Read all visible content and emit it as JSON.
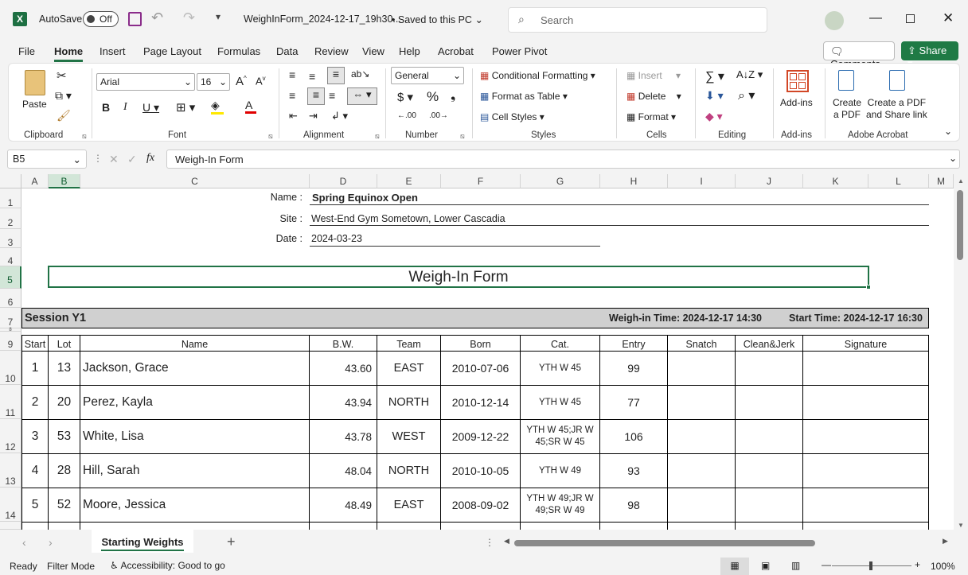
{
  "titlebar": {
    "autosave_label": "AutoSave",
    "autosave_state": "Off",
    "filename": "WeighInForm_2024-12-17_19h30...",
    "saved_status": "Saved to this PC",
    "search_placeholder": "Search"
  },
  "tabs": [
    "File",
    "Home",
    "Insert",
    "Page Layout",
    "Formulas",
    "Data",
    "Review",
    "View",
    "Help",
    "Acrobat",
    "Power Pivot"
  ],
  "comments_label": "Comments",
  "share_label": "Share",
  "ribbon": {
    "clipboard": {
      "paste": "Paste",
      "label": "Clipboard"
    },
    "font": {
      "name": "Arial",
      "size": "16",
      "label": "Font"
    },
    "alignment": {
      "label": "Alignment"
    },
    "number": {
      "format": "General",
      "label": "Number"
    },
    "styles": {
      "conditional": "Conditional Formatting",
      "table": "Format as Table",
      "cell": "Cell Styles",
      "label": "Styles"
    },
    "cells": {
      "insert": "Insert",
      "delete": "Delete",
      "format": "Format",
      "label": "Cells"
    },
    "editing": {
      "label": "Editing"
    },
    "addins": {
      "btn": "Add-ins",
      "label": "Add-ins"
    },
    "acrobat": {
      "create1": "Create",
      "create2": "a PDF",
      "share1": "Create a PDF",
      "share2": "and Share link",
      "label": "Adobe Acrobat"
    }
  },
  "formula_bar": {
    "name_box": "B5",
    "fx": "fx",
    "value": "Weigh-In Form"
  },
  "columns": [
    "A",
    "B",
    "C",
    "D",
    "E",
    "F",
    "G",
    "H",
    "I",
    "J",
    "K",
    "L",
    "M"
  ],
  "rows": [
    "1",
    "2",
    "3",
    "4",
    "5",
    "6",
    "7",
    "8",
    "9",
    "10",
    "11",
    "12",
    "13",
    "14"
  ],
  "sheet": {
    "name_label": "Name :",
    "name_value": "Spring Equinox Open",
    "site_label": "Site :",
    "site_value": "West-End Gym Sometown, Lower Cascadia",
    "date_label": "Date :",
    "date_value": "2024-03-23",
    "form_title": "Weigh-In Form",
    "session": "Session Y1",
    "weighin_time": "Weigh-in Time: 2024-12-17 14:30",
    "start_time": "Start Time: 2024-12-17 16:30",
    "headers": [
      "Start",
      "Lot",
      "Name",
      "B.W.",
      "Team",
      "Born",
      "Cat.",
      "Entry",
      "Snatch",
      "Clean&Jerk",
      "Signature"
    ],
    "athletes": [
      {
        "start": "1",
        "lot": "13",
        "name": "Jackson, Grace",
        "bw": "43.60",
        "team": "EAST",
        "born": "2010-07-06",
        "cat": "YTH W 45",
        "entry": "99"
      },
      {
        "start": "2",
        "lot": "20",
        "name": "Perez, Kayla",
        "bw": "43.94",
        "team": "NORTH",
        "born": "2010-12-14",
        "cat": "YTH W 45",
        "entry": "77"
      },
      {
        "start": "3",
        "lot": "53",
        "name": "White, Lisa",
        "bw": "43.78",
        "team": "WEST",
        "born": "2009-12-22",
        "cat": "YTH W 45;JR W 45;SR W 45",
        "entry": "106"
      },
      {
        "start": "4",
        "lot": "28",
        "name": "Hill, Sarah",
        "bw": "48.04",
        "team": "NORTH",
        "born": "2010-10-05",
        "cat": "YTH W 49",
        "entry": "93"
      },
      {
        "start": "5",
        "lot": "52",
        "name": "Moore, Jessica",
        "bw": "48.49",
        "team": "EAST",
        "born": "2008-09-02",
        "cat": "YTH W 49;JR W 49;SR W 49",
        "entry": "98"
      }
    ]
  },
  "sheet_tab": "Starting Weights",
  "status": {
    "ready": "Ready",
    "filter": "Filter Mode",
    "accessibility": "Accessibility: Good to go",
    "zoom": "100%"
  }
}
